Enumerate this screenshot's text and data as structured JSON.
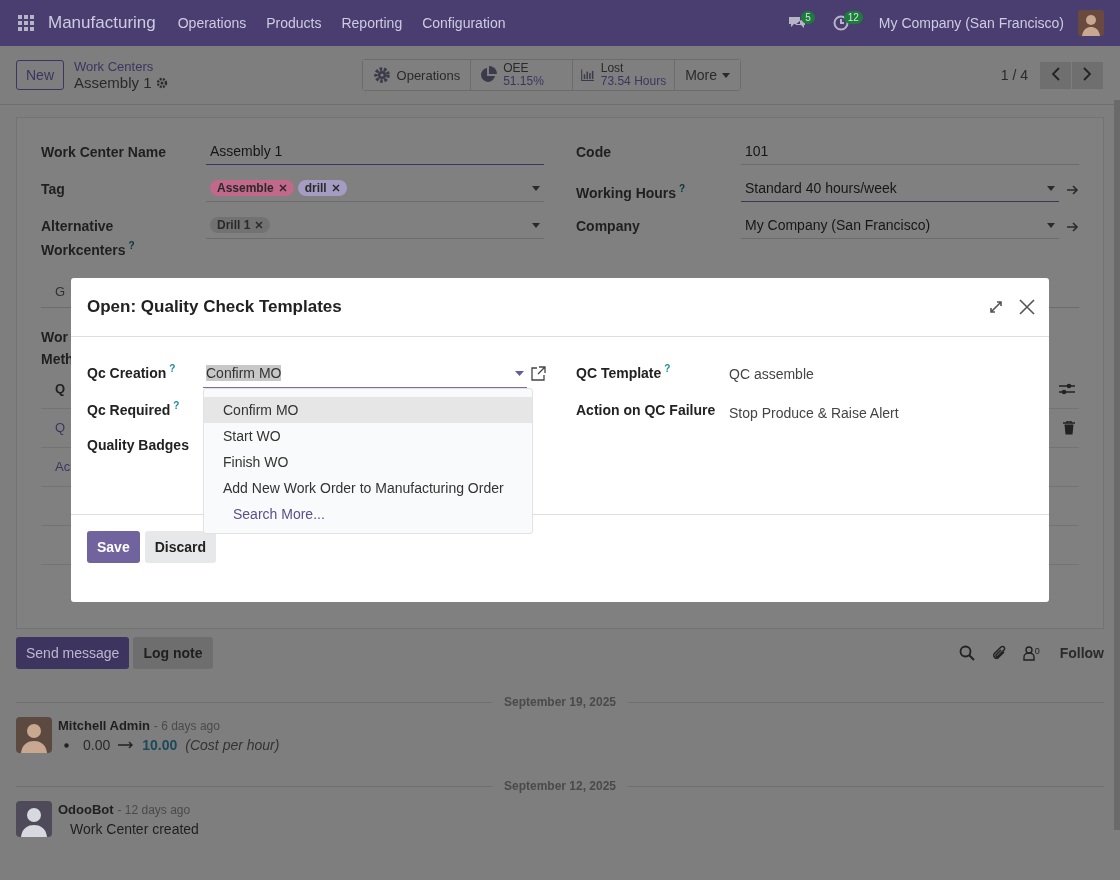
{
  "navbar": {
    "app_name": "Manufacturing",
    "menu": [
      "Operations",
      "Products",
      "Reporting",
      "Configuration"
    ],
    "messages_count": "5",
    "activities_count": "12",
    "company": "My Company (San Francisco)"
  },
  "control_panel": {
    "new_button": "New",
    "breadcrumb": "Work Centers",
    "record": "Assembly 1",
    "pager": "1 / 4",
    "smart_buttons": [
      {
        "kind": "action",
        "label": "Operations"
      },
      {
        "kind": "stat",
        "label": "OEE",
        "value": "51.15%"
      },
      {
        "kind": "stat",
        "label": "Lost",
        "value": "73.54 Hours"
      },
      {
        "kind": "dropdown",
        "label": "More"
      }
    ]
  },
  "form": {
    "left": [
      {
        "label": "Work Center Name",
        "kind": "text",
        "value": "Assembly 1"
      },
      {
        "label": "Tag",
        "kind": "tags",
        "tags": [
          {
            "label": "Assemble",
            "color": "#c2688a"
          },
          {
            "label": "drill",
            "color": "#a49cc2"
          }
        ]
      },
      {
        "label": "Alternative Workcenters",
        "help": "?",
        "kind": "tags",
        "tags": [
          {
            "label": "Drill 1",
            "color": "#727272"
          }
        ]
      }
    ],
    "right": [
      {
        "label": "Code",
        "kind": "text",
        "value": "101"
      },
      {
        "label": "Working Hours",
        "help": "?",
        "kind": "select",
        "value": "Standard 40 hours/week",
        "focused": true
      },
      {
        "label": "Company",
        "kind": "select",
        "value": "My Company (San Francisco)",
        "focused": false
      }
    ],
    "tab_partial": "G",
    "label_partial": [
      "Wor",
      "Meth"
    ],
    "list_header_partial": "Q",
    "list_rows_partial": [
      "Q",
      "Ac"
    ]
  },
  "dialog": {
    "title": "Open: Quality Check Templates",
    "left": [
      {
        "label": "Qc Creation",
        "help": "?",
        "value": "Confirm MO"
      },
      {
        "label": "Qc Required",
        "help": "?"
      },
      {
        "label": "Quality Badges"
      }
    ],
    "right": [
      {
        "label": "QC Template",
        "help": "?",
        "value": "QC assemble"
      },
      {
        "label": "Action on QC Failure",
        "value": "Stop Produce & Raise Alert"
      }
    ],
    "dropdown": {
      "options": [
        {
          "label": "Confirm MO",
          "selected": true
        },
        {
          "label": "Start WO",
          "selected": false
        },
        {
          "label": "Finish WO",
          "selected": false
        },
        {
          "label": "Add New Work Order to Manufacturing Order",
          "selected": false
        }
      ],
      "search_more": "Search More..."
    },
    "buttons": [
      {
        "label": "Save",
        "kind": "primary"
      },
      {
        "label": "Discard",
        "kind": "secondary"
      }
    ]
  },
  "chatter": {
    "send_message": "Send message",
    "log_note": "Log note",
    "followers_count": "0",
    "follow": "Follow",
    "messages": [
      {
        "date": "September 19, 2025",
        "author": "Mitchell Admin",
        "time": "- 6 days ago",
        "kind": "tracking",
        "old_value": "0.00",
        "new_value": "10.00",
        "field": "(Cost per hour)"
      },
      {
        "date": "September 12, 2025",
        "author": "OdooBot",
        "time": "- 12 days ago",
        "kind": "text",
        "body": "Work Center created"
      }
    ]
  }
}
